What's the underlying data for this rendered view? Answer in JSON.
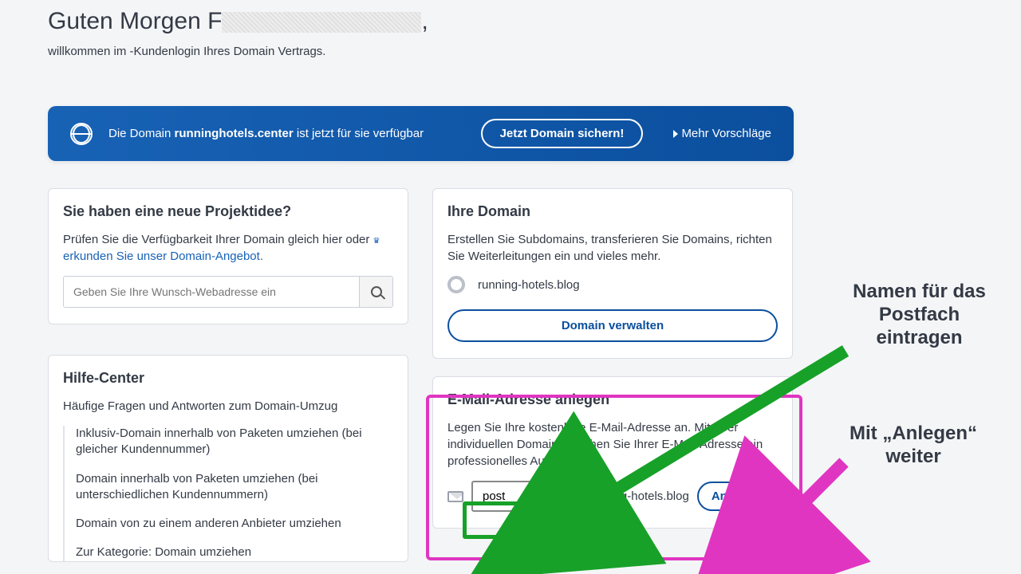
{
  "greeting": {
    "prefix": "Guten Morgen F",
    "suffix": ","
  },
  "welcome": "willkommen im -Kundenlogin Ihres Domain Vertrags.",
  "banner": {
    "text_pre": "Die Domain ",
    "domain": "runninghotels.center",
    "text_post": " ist jetzt für sie verfügbar",
    "cta": "Jetzt Domain sichern!",
    "more": "Mehr Vorschläge"
  },
  "project": {
    "title": "Sie haben eine neue Projektidee?",
    "text": "Prüfen Sie die Verfügbarkeit Ihrer Domain gleich hier oder ",
    "link": "erkunden Sie unser Domain-Angebot.",
    "placeholder": "Geben Sie Ihre Wunsch-Webadresse ein"
  },
  "help": {
    "title": "Hilfe-Center",
    "subtitle": "Häufige Fragen und Antworten zum Domain-Umzug",
    "items": [
      "Inklusiv-Domain innerhalb von Paketen umziehen (bei gleicher Kundennummer)",
      "Domain innerhalb von Paketen umziehen (bei unterschiedlichen Kundennummern)",
      "Domain von zu einem anderen Anbieter umziehen",
      "Zur Kategorie: Domain umziehen"
    ]
  },
  "domain": {
    "title": "Ihre Domain",
    "text": "Erstellen Sie Subdomains, transferieren Sie Domains, richten Sie Weiterleitungen ein und vieles mehr.",
    "name": "running-hotels.blog",
    "manage": "Domain verwalten"
  },
  "email": {
    "title": "E-Mail-Adresse anlegen",
    "text": "Legen Sie Ihre kostenlose E-Mail-Adresse an. Mit Ihrer individuellen Domain verleihen Sie Ihrer E-Mail-Adresse ein professionelles Aussehen.",
    "value": "post",
    "suffix": "@running-hotels.blog",
    "button": "Anlegen"
  },
  "annotations": {
    "input_note": "Namen für das Postfach eintragen",
    "button_note": "Mit „Anlegen“ weiter"
  }
}
